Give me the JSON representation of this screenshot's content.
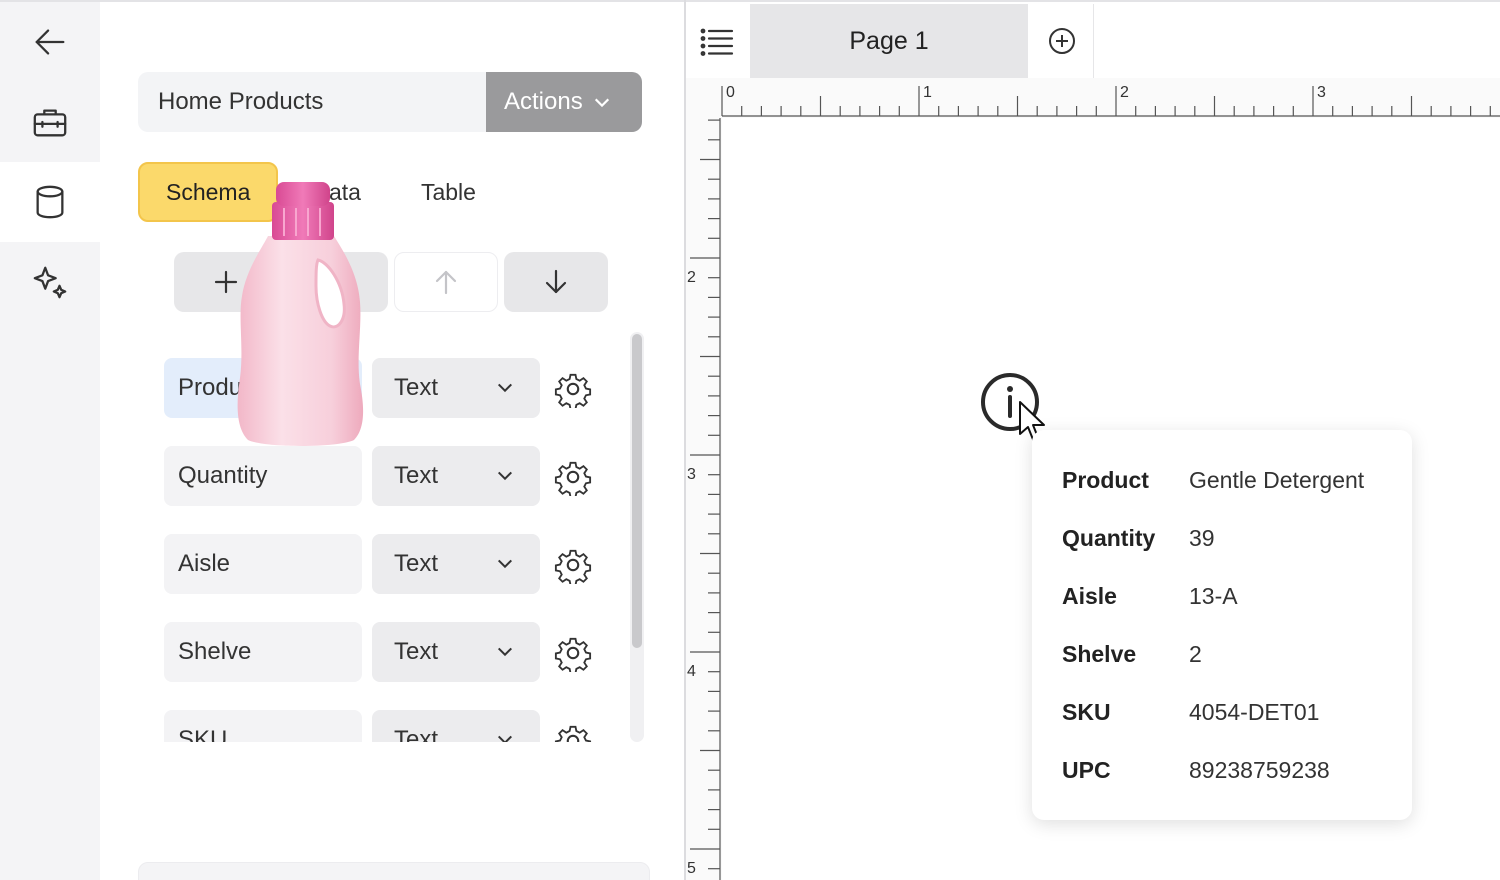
{
  "rail": {
    "items": [
      {
        "icon": "back-arrow-icon"
      },
      {
        "icon": "briefcase-icon"
      },
      {
        "icon": "database-icon"
      },
      {
        "icon": "sparkles-icon"
      }
    ]
  },
  "schema": {
    "name_value": "Home Products",
    "actions_label": "Actions",
    "tabs": [
      {
        "label": "Schema",
        "active": true
      },
      {
        "label": "Data",
        "active": false
      },
      {
        "label": "Table",
        "active": false
      }
    ],
    "fields": [
      {
        "name": "Product",
        "type": "Text"
      },
      {
        "name": "Quantity",
        "type": "Text"
      },
      {
        "name": "Aisle",
        "type": "Text"
      },
      {
        "name": "Shelve",
        "type": "Text"
      },
      {
        "name": "SKU",
        "type": "Text"
      }
    ]
  },
  "designer": {
    "page_tab_label": "Page 1",
    "ruler_top_labels": [
      "0",
      "1",
      "2",
      "3"
    ],
    "ruler_left_labels": [
      "2",
      "3",
      "4",
      "5"
    ]
  },
  "popup": {
    "rows": [
      {
        "key": "Product",
        "value": "Gentle Detergent"
      },
      {
        "key": "Quantity",
        "value": "39"
      },
      {
        "key": "Aisle",
        "value": "13-A"
      },
      {
        "key": "Shelve",
        "value": "2"
      },
      {
        "key": "SKU",
        "value": "4054-DET01"
      },
      {
        "key": "UPC",
        "value": "89238759238"
      }
    ]
  },
  "colors": {
    "active_tab": "#fbd96b",
    "actions_button": "#9a9a9c",
    "selected_field": "#e3edfb",
    "product_pink": "#e75ea6"
  }
}
